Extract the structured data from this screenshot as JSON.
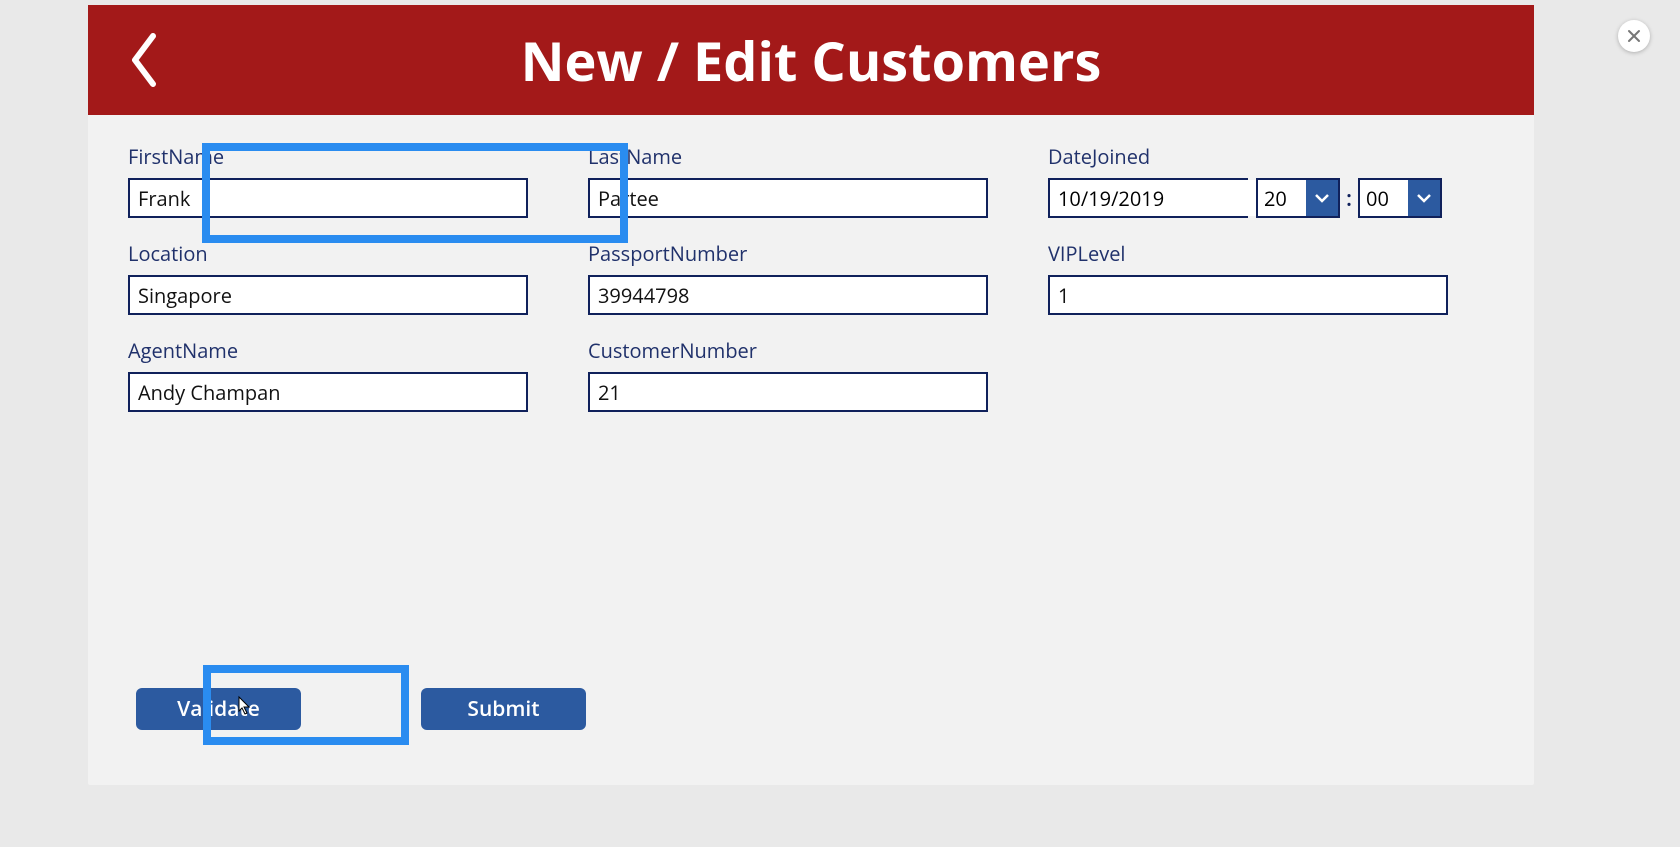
{
  "header": {
    "title": "New / Edit Customers"
  },
  "fields": {
    "firstName": {
      "label": "FirstName",
      "value": "Frank"
    },
    "lastName": {
      "label": "LastName",
      "value": "Partee"
    },
    "dateJoined": {
      "label": "DateJoined",
      "date": "10/19/2019",
      "hour": "20",
      "minute": "00"
    },
    "location": {
      "label": "Location",
      "value": "Singapore"
    },
    "passportNumber": {
      "label": "PassportNumber",
      "value": "39944798"
    },
    "vipLevel": {
      "label": "VIPLevel",
      "value": "1"
    },
    "agentName": {
      "label": "AgentName",
      "value": "Andy Champan"
    },
    "customerNumber": {
      "label": "CustomerNumber",
      "value": "21"
    }
  },
  "buttons": {
    "validate": "Validate",
    "submit": "Submit"
  },
  "timeSeparator": ":"
}
